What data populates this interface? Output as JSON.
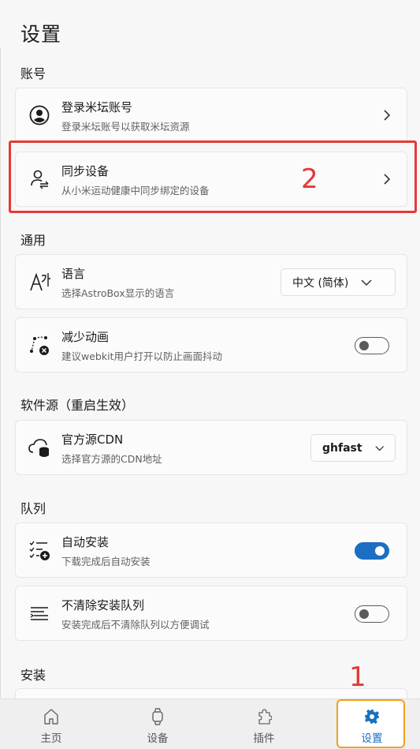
{
  "page": {
    "title": "设置"
  },
  "sections": {
    "account": "账号",
    "general": "通用",
    "source": "软件源（重启生效）",
    "queue": "队列",
    "install": "安装"
  },
  "account": {
    "login": {
      "label": "登录米坛账号",
      "desc": "登录米坛账号以获取米坛资源",
      "icon": "account-circle-icon"
    },
    "sync": {
      "label": "同步设备",
      "desc": "从小米运动健康中同步绑定的设备",
      "icon": "person-sync-icon"
    }
  },
  "general": {
    "language": {
      "label": "语言",
      "desc": "选择AstroBox显示的语言",
      "value": "中文 (简体)",
      "icon": "translate-icon"
    },
    "reduce_motion": {
      "label": "减少动画",
      "desc": "建议webkit用户打开以防止画面抖动",
      "enabled": false,
      "icon": "motion-off-icon"
    }
  },
  "source": {
    "cdn": {
      "label": "官方源CDN",
      "desc": "选择官方源的CDN地址",
      "value": "ghfast",
      "icon": "cloud-database-icon"
    }
  },
  "queue": {
    "auto_install": {
      "label": "自动安装",
      "desc": "下载完成后自动安装",
      "enabled": true,
      "icon": "list-add-icon"
    },
    "keep_queue": {
      "label": "不清除安装队列",
      "desc": "安装完成后不清除队列以方便调试",
      "enabled": false,
      "icon": "text-lines-icon"
    }
  },
  "tabs": [
    {
      "label": "主页",
      "icon": "home-icon"
    },
    {
      "label": "设备",
      "icon": "watch-icon"
    },
    {
      "label": "插件",
      "icon": "puzzle-icon"
    },
    {
      "label": "设置",
      "icon": "gear-icon",
      "active": true
    }
  ],
  "annotations": {
    "one": "1",
    "two": "2"
  },
  "colors": {
    "accent": "#1b6ec2",
    "annotation": "#e53935",
    "active_tab_border": "#f0a020"
  }
}
